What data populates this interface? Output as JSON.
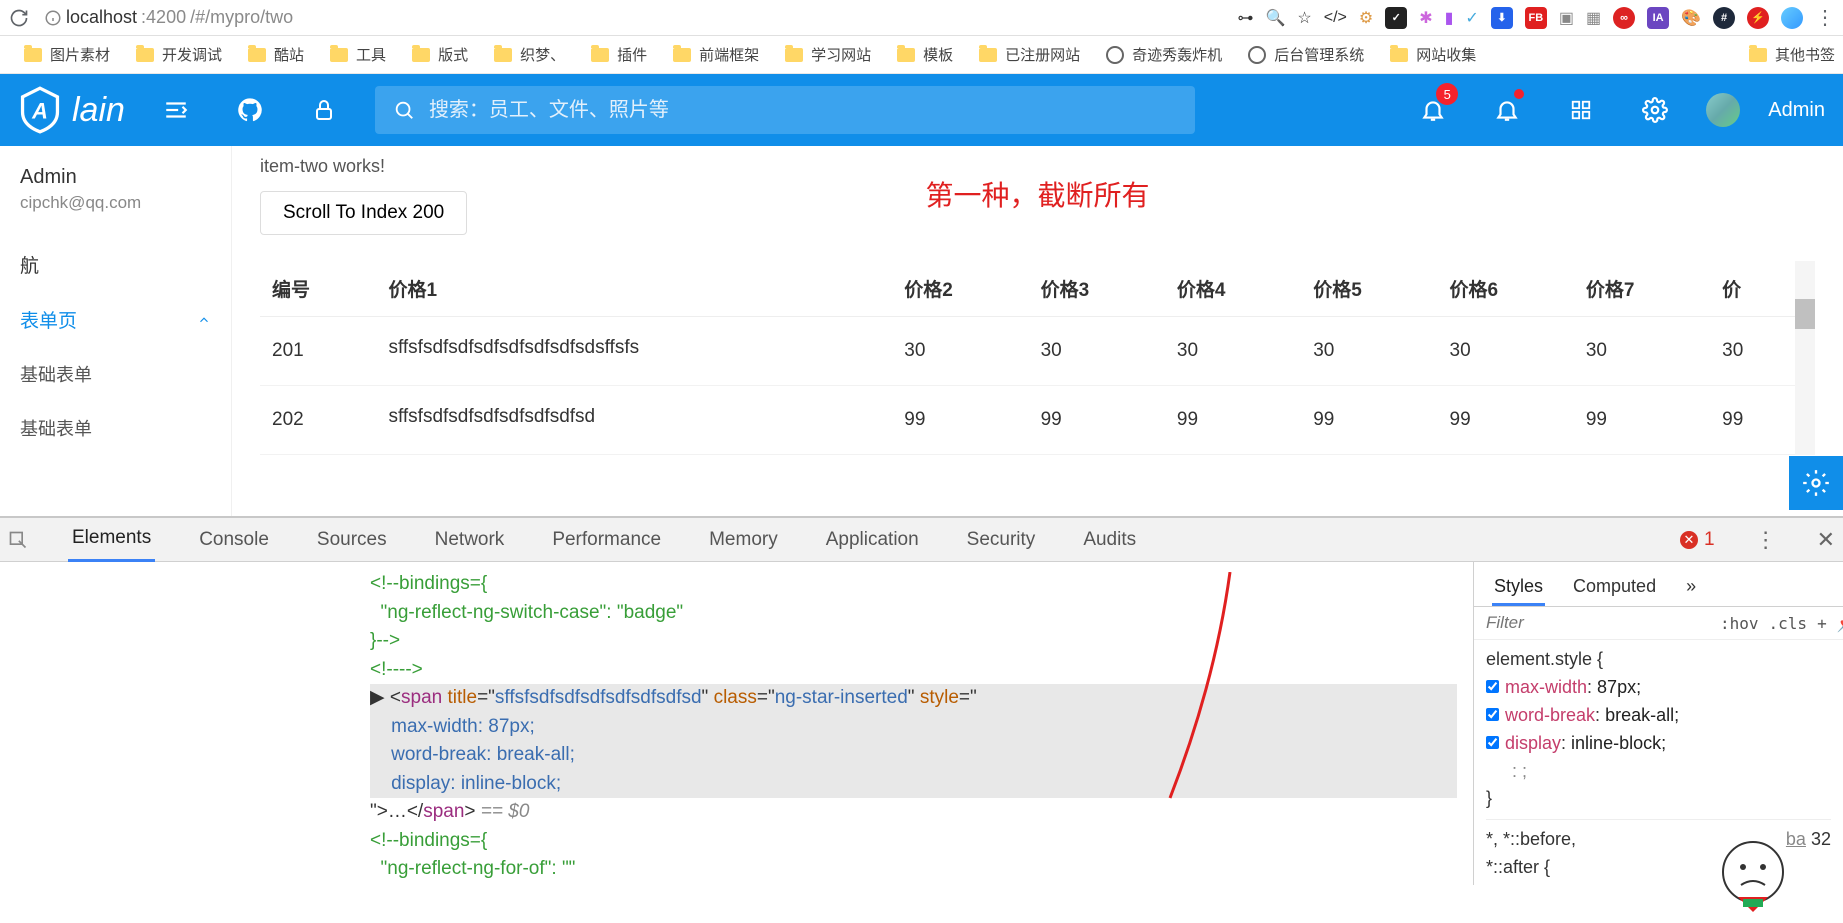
{
  "browser": {
    "url_host": "localhost",
    "url_port": ":4200",
    "url_path": "/#/mypro/two"
  },
  "bookmarks": [
    "图片素材",
    "开发调试",
    "酷站",
    "工具",
    "版式",
    "织梦、",
    "插件",
    "前端框架",
    "学习网站",
    "模板",
    "已注册网站",
    "奇迹秀轰炸机",
    "后台管理系统",
    "网站收集",
    "其他书签"
  ],
  "header": {
    "search_placeholder": "搜索：员工、文件、照片等",
    "badge_count": "5",
    "user_label": "Admin"
  },
  "sidebar": {
    "user_name": "Admin",
    "user_email": "cipchk@qq.com",
    "nav_label": "航",
    "menu_parent": "表单页",
    "menu_sub1": "基础表单",
    "menu_sub2": "基础表单"
  },
  "content": {
    "works_line": "item-two works!",
    "scroll_button": "Scroll To Index 200",
    "banner": "第一种，截断所有",
    "headers": [
      "编号",
      "价格1",
      "价格2",
      "价格3",
      "价格4",
      "价格5",
      "价格6",
      "价格7",
      "价"
    ],
    "rows": [
      {
        "id": "201",
        "txt": "sffsfsdfsdfsdfsdfsdfsdfsdsffsfs",
        "vals": [
          "30",
          "30",
          "30",
          "30",
          "30",
          "30",
          "30"
        ]
      },
      {
        "id": "202",
        "txt": "sffsfsdfsdfsdfsdfsdfsdfsd",
        "vals": [
          "99",
          "99",
          "99",
          "99",
          "99",
          "99",
          "99"
        ]
      }
    ]
  },
  "devtools": {
    "tabs": [
      "Elements",
      "Console",
      "Sources",
      "Network",
      "Performance",
      "Memory",
      "Application",
      "Security",
      "Audits"
    ],
    "error_count": "1",
    "styles_tabs": [
      "Styles",
      "Computed"
    ],
    "filter_placeholder": "Filter",
    "hov": ":hov",
    "cls": ".cls",
    "elem_style": "element.style {",
    "rules": [
      {
        "name": "max-width",
        "val": "87px;"
      },
      {
        "name": "word-break",
        "val": "break-all;"
      },
      {
        "name": "display",
        "val": "inline-block;"
      }
    ],
    "empty_rule": ": ;",
    "close_brace": "}",
    "inherited1": "*, *::before,",
    "inherited2": "*::after {",
    "src_link": "ba",
    "src_link_num": "32",
    "html_lines": {
      "l1": "<!--bindings={",
      "l2": "  \"ng-reflect-ng-switch-case\": \"badge\"",
      "l3": "}-->",
      "l4": "<!---->",
      "l5_open": "▶ <",
      "l5_tag": "span",
      "l5_attr_title": " title",
      "l5_eq": "=\"",
      "l5_title_val": "sffsfsdfsdfsdfsdfsdfsdfsd",
      "l5_mid": "\" ",
      "l5_attr_class": "class",
      "l5_class_val": "ng-star-inserted",
      "l5_attr_style": "style",
      "l5_style_open": "=\"",
      "l6": "    max-width: 87px;",
      "l7": "    word-break: break-all;",
      "l8": "    display: inline-block;",
      "l9_a": "\">…</",
      "l9_tag": "span",
      "l9_b": "> ",
      "l9_sel": "== $0",
      "l10": "<!--bindings={",
      "l11": "  \"ng-reflect-ng-for-of\": \"\"",
      "l12": "}-->"
    }
  }
}
